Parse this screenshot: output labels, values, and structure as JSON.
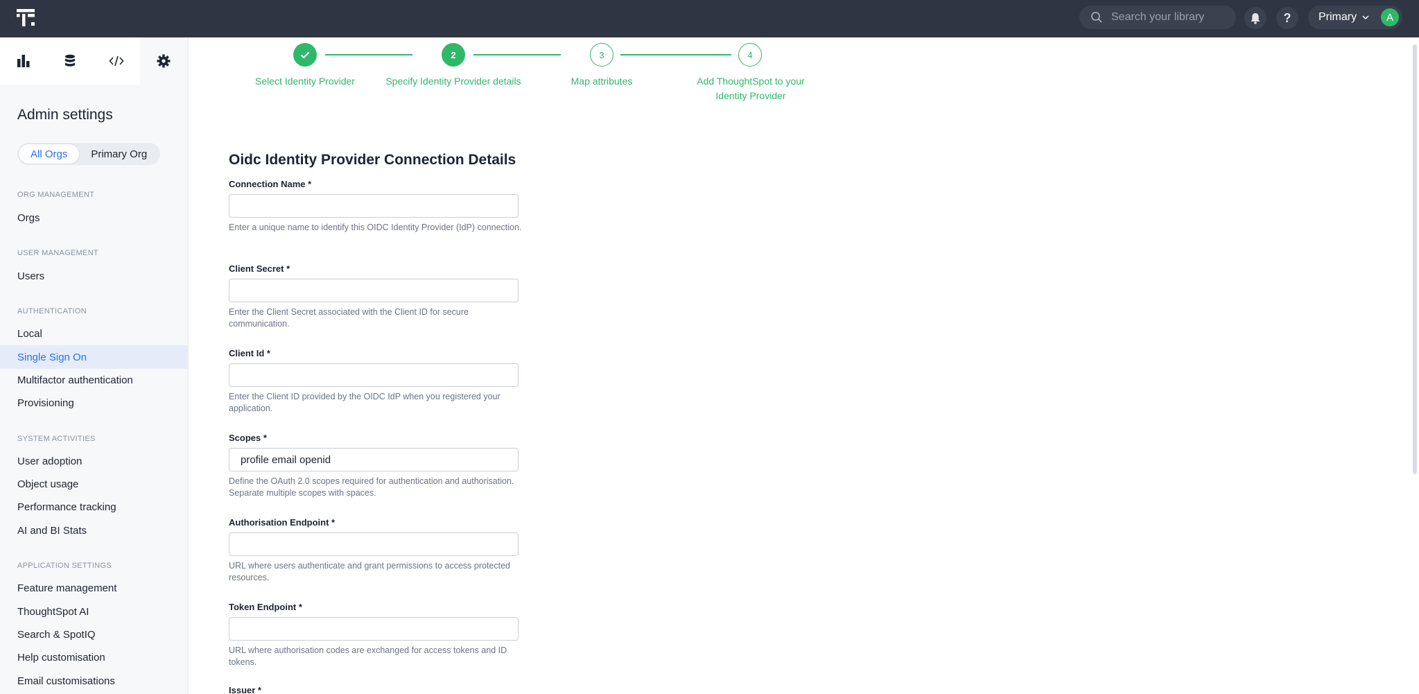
{
  "topbar": {
    "search_placeholder": "Search your library",
    "org_label": "Primary",
    "avatar_initial": "A"
  },
  "sidebar": {
    "title": "Admin settings",
    "org_toggle": [
      "All Orgs",
      "Primary Org"
    ],
    "sections": {
      "org_management": "ORG MANAGEMENT",
      "user_management": "USER MANAGEMENT",
      "authentication": "AUTHENTICATION",
      "system_activities": "SYSTEM ACTIVITIES",
      "application_settings": "APPLICATION SETTINGS"
    },
    "items": {
      "orgs": "Orgs",
      "users": "Users",
      "local": "Local",
      "sso": "Single Sign On",
      "mfa": "Multifactor authentication",
      "provisioning": "Provisioning",
      "user_adoption": "User adoption",
      "object_usage": "Object usage",
      "performance_tracking": "Performance tracking",
      "ai_bi_stats": "AI and BI Stats",
      "feature_management": "Feature management",
      "thoughtspot_ai": "ThoughtSpot AI",
      "search_spotiq": "Search & SpotIQ",
      "help_customisation": "Help customisation",
      "email_customisations": "Email customisations"
    }
  },
  "stepper": {
    "steps": [
      {
        "number": "",
        "label": "Select Identity Provider",
        "state": "done"
      },
      {
        "number": "2",
        "label": "Specify Identity Provider details",
        "state": "current"
      },
      {
        "number": "3",
        "label": "Map attributes",
        "state": "todo"
      },
      {
        "number": "4",
        "label": "Add ThoughtSpot to your Identity Provider",
        "state": "todo"
      }
    ],
    "accent": "#30b86a"
  },
  "form": {
    "title": "Oidc Identity Provider Connection Details",
    "fields": [
      {
        "label": "Connection Name *",
        "value": "",
        "help": "Enter a unique name to identify this OIDC Identity Provider (IdP) connection."
      },
      {
        "label": "Client Secret *",
        "value": "",
        "help": "Enter the Client Secret associated with the Client ID for secure communication."
      },
      {
        "label": "Client Id *",
        "value": "",
        "help": "Enter the Client ID provided by the OIDC IdP when you registered your application."
      },
      {
        "label": "Scopes *",
        "value": "profile email openid",
        "help": "Define the OAuth 2.0 scopes required for authentication and authorisation. Separate multiple scopes with spaces."
      },
      {
        "label": "Authorisation Endpoint *",
        "value": "",
        "help": "URL where users authenticate and grant permissions to access protected resources."
      },
      {
        "label": "Token Endpoint *",
        "value": "",
        "help": "URL where authorisation codes are exchanged for access tokens and ID tokens."
      },
      {
        "label": "Issuer *",
        "value": "",
        "help": ""
      }
    ]
  },
  "colors": {
    "topbar": "#2f3542",
    "active_nav": "#2770ef",
    "success": "#30b86a"
  }
}
